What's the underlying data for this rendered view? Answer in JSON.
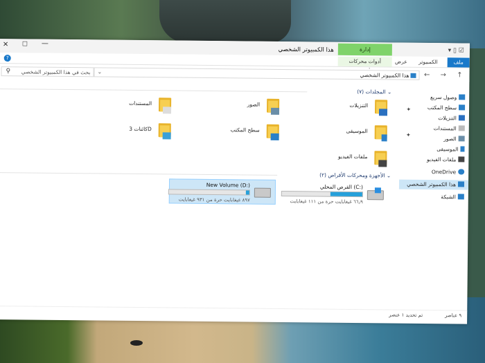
{
  "window": {
    "title": "هذا الكمبيوتر الشخصي",
    "close_glyph": "✕",
    "maximize_glyph": "☐",
    "minimize_glyph": "—",
    "collapse_glyph": "⌄",
    "qat_glyphs": "▾ ▯ ☑",
    "help_glyph": "?"
  },
  "ribbon": {
    "context_tab_top": "إدارة",
    "tabs": {
      "file": "ملف",
      "computer": "الكمبيوتر",
      "view": "عرض",
      "drive_tools": "أدوات محركات الأقراص"
    }
  },
  "address": {
    "path": "هذا الكمبيوتر الشخصي",
    "chevron": "⌄",
    "refresh_glyph": "↻",
    "nav_glyph": "← → ↑",
    "search_placeholder": "بحث في هذا الكمبيوتر الشخصي",
    "search_glyph": "⚲"
  },
  "nav": {
    "quick_access": "وصول سريع",
    "desktop": "سطح المكتب",
    "downloads": "التنزيلات",
    "documents": "المستندات",
    "pictures": "الصور",
    "music": "الموسيقى",
    "videos": "ملفات الفيديو",
    "onedrive": "OneDrive",
    "this_pc": "هذا الكمبيوتر الشخصي",
    "network": "الشبكة"
  },
  "folders_group": {
    "title": "المجلدات (٧)",
    "items": {
      "downloads": "التنزيلات",
      "pictures": "الصور",
      "documents": "المستندات",
      "music": "الموسيقى",
      "desktop": "سطح المكتب",
      "objects3d": "كائنات 3D",
      "videos": "ملفات الفيديو"
    },
    "pin_glyph": "✦"
  },
  "drives_group": {
    "title": "الأجهزة ومحركات الأقراص (٢)",
    "local_disk": {
      "name": "القرص المحلي (C:)",
      "space": "٦٦٫٩ غيغابايت حرة من ١١١ غيغابايت",
      "used_fraction": 0.4
    },
    "new_volume": {
      "name": "New Volume (D:)",
      "space": "٨٩٧ غيغابايت حرة من ٩٣١ غيغابايت",
      "used_fraction": 0.04
    }
  },
  "status": {
    "items_count": "٩ عناصر",
    "selected": "تم تحديد ١ عنصر"
  },
  "colors": {
    "accent": "#1979ca",
    "context_green": "#7fd36a",
    "folder": "#f7cf52",
    "selection": "#cde6f7"
  }
}
